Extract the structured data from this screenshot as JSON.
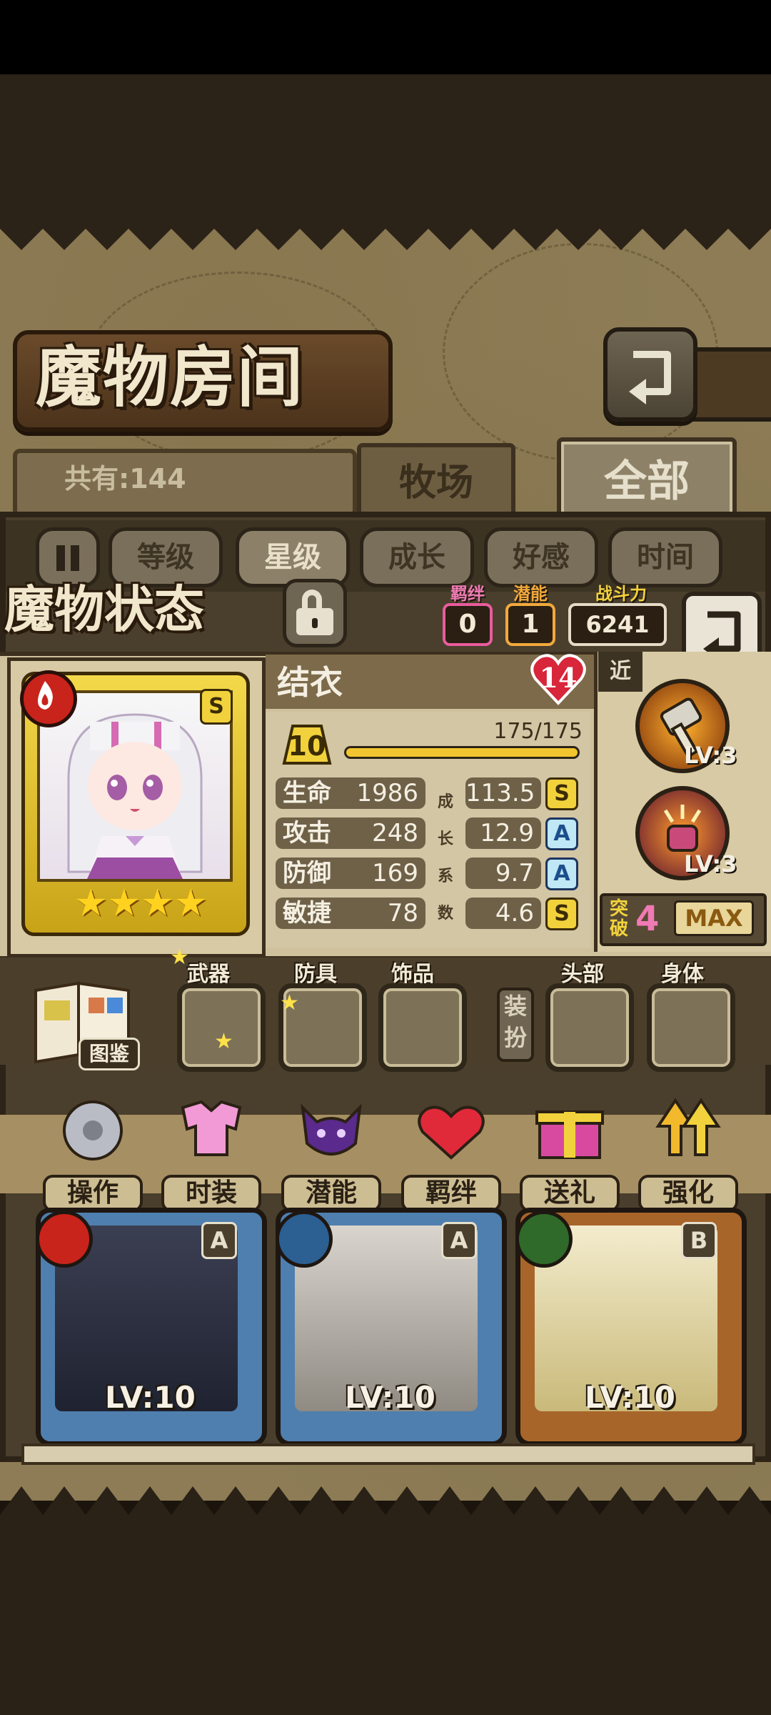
{
  "header": {
    "title": "魔物房间",
    "back_icon": "return-arrow-icon"
  },
  "count": {
    "label": "共有:144"
  },
  "tabs": [
    {
      "label": "牧场",
      "active": false
    },
    {
      "label": "全部",
      "active": true
    }
  ],
  "filters": [
    {
      "label": "等级",
      "active": false
    },
    {
      "label": "星级",
      "active": true
    },
    {
      "label": "成长",
      "active": false
    },
    {
      "label": "好感",
      "active": false
    },
    {
      "label": "时间",
      "active": false
    }
  ],
  "status": {
    "title": "魔物状态",
    "bond_label": "羁绊",
    "bond_value": "0",
    "potential_label": "潜能",
    "potential_value": "1",
    "power_label": "战斗力",
    "power_value": "6241"
  },
  "monster": {
    "name": "结衣",
    "affection": "14",
    "grade": "S",
    "element": "fire",
    "stars": 4,
    "level": "10",
    "exp_text": "175/175",
    "exp_fraction": 1.0,
    "stats": [
      {
        "name": "生命",
        "value": "1986",
        "growth": "113.5",
        "grade": "S"
      },
      {
        "name": "攻击",
        "value": "248",
        "growth": "12.9",
        "grade": "A"
      },
      {
        "name": "防御",
        "value": "169",
        "growth": "9.7",
        "grade": "A"
      },
      {
        "name": "敏捷",
        "value": "78",
        "growth": "4.6",
        "grade": "S"
      }
    ],
    "growth_label": [
      "成",
      "长",
      "系",
      "数"
    ],
    "attack_type": "近",
    "skills": [
      {
        "icon": "hammer-skill-icon",
        "level": "LV:3"
      },
      {
        "icon": "fist-skill-icon",
        "level": "LV:3"
      }
    ],
    "breakthrough_label": [
      "突",
      "破"
    ],
    "breakthrough_value": "4",
    "breakthrough_max": "MAX"
  },
  "equipment": {
    "book_label": "图鉴",
    "slots": [
      "武器",
      "防具",
      "饰品"
    ],
    "dress_label": "装扮",
    "costume_slots": [
      "头部",
      "身体"
    ]
  },
  "actions": [
    {
      "label": "操作",
      "icon": "gear-icon"
    },
    {
      "label": "时装",
      "icon": "outfit-icon"
    },
    {
      "label": "潜能",
      "icon": "demon-icon"
    },
    {
      "label": "羁绊",
      "icon": "hearts-icon"
    },
    {
      "label": "送礼",
      "icon": "gift-icon"
    },
    {
      "label": "强化",
      "icon": "upgrade-arrows-icon"
    }
  ],
  "cards": [
    {
      "element": "fire",
      "grade": "A",
      "level": "LV:10",
      "frame": "#4f7fae"
    },
    {
      "element": "water",
      "grade": "A",
      "level": "LV:10",
      "frame": "#4f7fae"
    },
    {
      "element": "wood",
      "grade": "B",
      "level": "LV:10",
      "frame": "#a8652a"
    }
  ],
  "colors": {
    "accent_gold": "#f2d23c",
    "bond_pink": "#e85c9c",
    "potential_orange": "#f2a93c",
    "fire": "#c8241b",
    "water": "#2c5f92",
    "wood": "#2f6a2a"
  }
}
